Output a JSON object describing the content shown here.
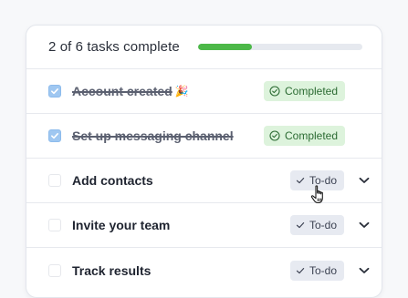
{
  "header": {
    "title": "2 of 6 tasks complete",
    "progress": 0.33
  },
  "tasks": [
    {
      "label": "Account created",
      "emoji": "🎉",
      "status": "Completed",
      "done": true
    },
    {
      "label": "Set up messaging channel",
      "status": "Completed",
      "done": true
    },
    {
      "label": "Add contacts",
      "status": "To-do",
      "done": false
    },
    {
      "label": "Invite your team",
      "status": "To-do",
      "done": false
    },
    {
      "label": "Track results",
      "status": "To-do",
      "done": false
    }
  ],
  "colors": {
    "progress_fill": "#4cb848",
    "completed_badge_bg": "#ddf3dc",
    "completed_badge_text": "#2c6b33",
    "todo_badge_bg": "#e7eaf1",
    "checkbox_checked": "#9fc7f1"
  },
  "icons": {
    "completed": "check-circle-icon",
    "todo": "check-icon",
    "expand": "chevron-down-icon",
    "cursor": "hand-pointer-icon",
    "emoji": "party-popper-icon"
  }
}
